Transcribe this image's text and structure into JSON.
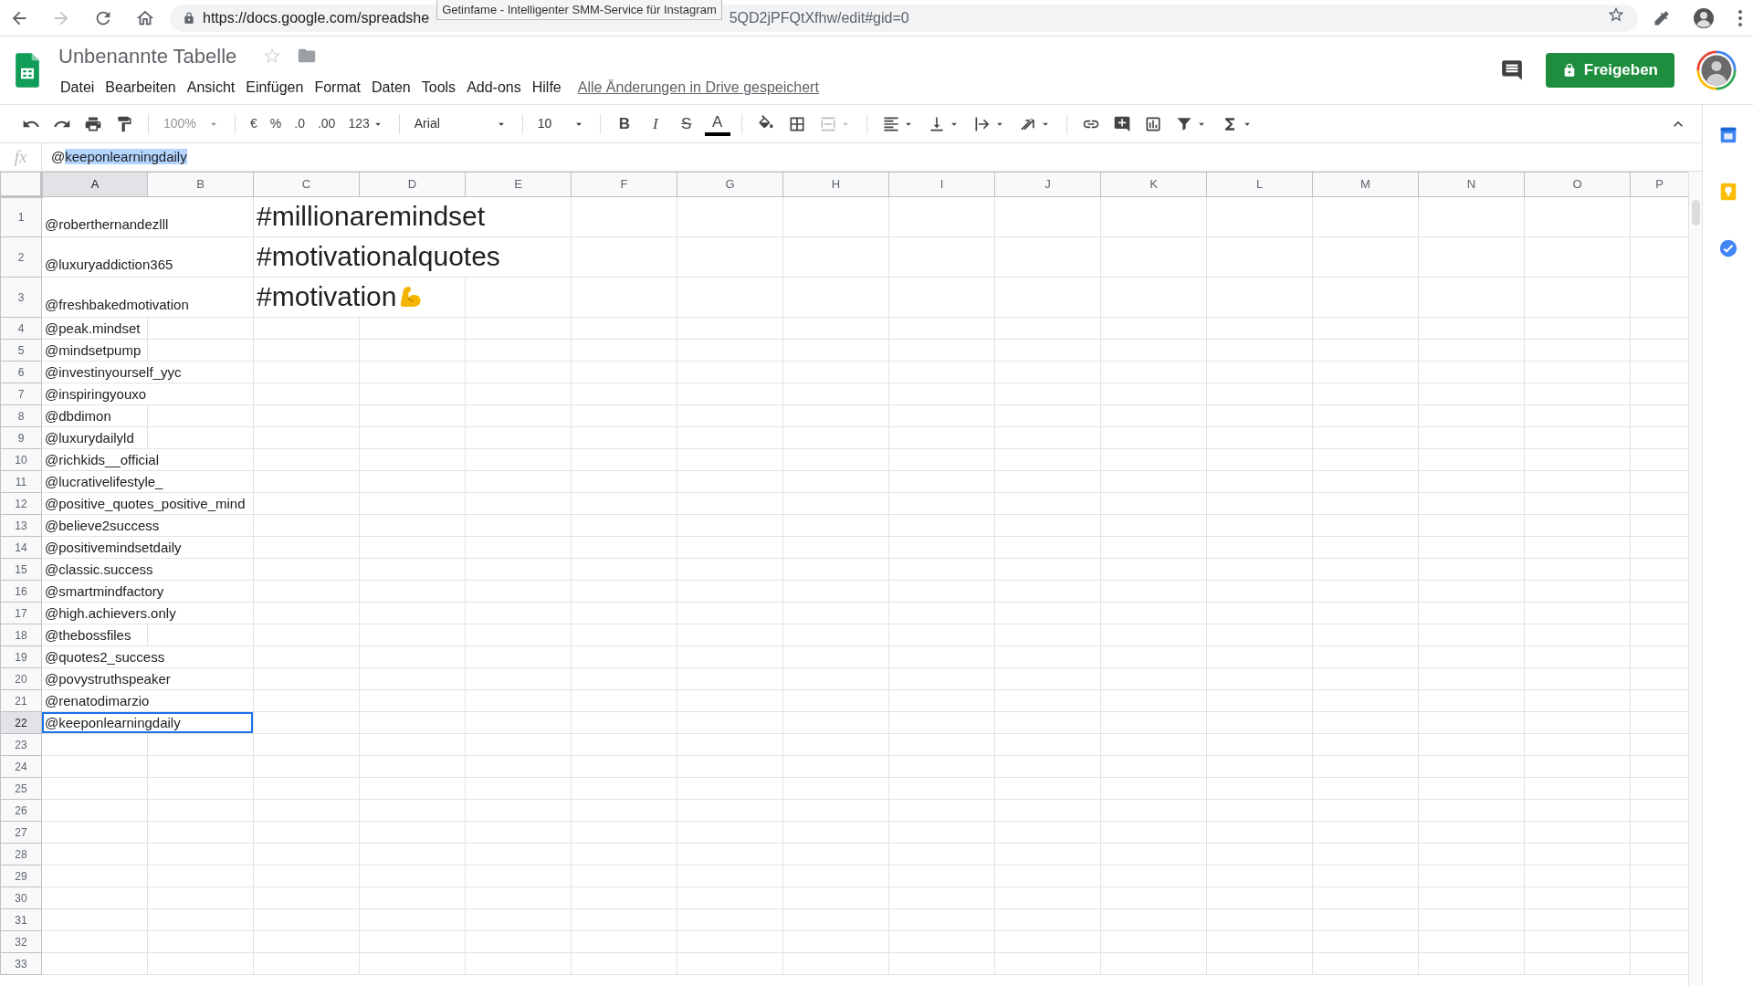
{
  "browser": {
    "url_start": "https://docs.google.com/spreadshe",
    "tooltip": "Getinfame - Intelligenter SMM-Service für Instagram",
    "url_end": "5QD2jPFQtXfhw/edit#gid=0",
    "forward_disabled": true
  },
  "document": {
    "title": "Unbenannte Tabelle",
    "menus": [
      "Datei",
      "Bearbeiten",
      "Ansicht",
      "Einfügen",
      "Format",
      "Daten",
      "Tools",
      "Add-ons",
      "Hilfe"
    ],
    "save_status": "Alle Änderungen in Drive gespeichert",
    "share_button": "Freigeben"
  },
  "toolbar": {
    "zoom": {
      "value": "100%",
      "disabled": true
    },
    "number_formats": [
      "€",
      "%",
      ".0",
      ".00",
      "123"
    ],
    "font": "Arial",
    "font_size": "10",
    "text_styles": [
      "B",
      "I",
      "S",
      "A"
    ],
    "merge_disabled": true
  },
  "formula_bar": {
    "label": "fx",
    "value": "@",
    "selected_text": "keeponlearningdaily"
  },
  "columns": [
    {
      "label": "A",
      "selected": true
    },
    {
      "label": "B",
      "selected": false
    },
    {
      "label": "C",
      "selected": false
    },
    {
      "label": "D",
      "selected": false
    },
    {
      "label": "E",
      "selected": false
    },
    {
      "label": "F",
      "selected": false
    },
    {
      "label": "G",
      "selected": false
    },
    {
      "label": "H",
      "selected": false
    },
    {
      "label": "I",
      "selected": false
    },
    {
      "label": "J",
      "selected": false
    },
    {
      "label": "K",
      "selected": false
    },
    {
      "label": "L",
      "selected": false
    },
    {
      "label": "M",
      "selected": false
    },
    {
      "label": "N",
      "selected": false
    },
    {
      "label": "O",
      "selected": false
    },
    {
      "label": "P",
      "selected": false
    }
  ],
  "rows": [
    {
      "number": "1",
      "a": "@roberthernandezlll",
      "c": "#millionaremindset",
      "selected": false
    },
    {
      "number": "2",
      "a": "@luxuryaddiction365",
      "c": "#motivationalquotes",
      "selected": false
    },
    {
      "number": "3",
      "a": "@freshbakedmotivation",
      "c": "#motivation",
      "icon": true,
      "selected": false
    },
    {
      "number": "4",
      "a": "@peak.mindset",
      "selected": false
    },
    {
      "number": "5",
      "a": "@mindsetpump",
      "selected": false
    },
    {
      "number": "6",
      "a": "@investinyourself_yyc",
      "selected": false
    },
    {
      "number": "7",
      "a": "@inspiringyouxo",
      "selected": false
    },
    {
      "number": "8",
      "a": "@dbdimon",
      "selected": false
    },
    {
      "number": "9",
      "a": "@luxurydailyld",
      "selected": false
    },
    {
      "number": "10",
      "a": "@richkids__official",
      "selected": false
    },
    {
      "number": "11",
      "a": "@lucrativelifestyle_",
      "selected": false
    },
    {
      "number": "12",
      "a": "@positive_quotes_positive_mind",
      "selected": false
    },
    {
      "number": "13",
      "a": "@believe2success",
      "selected": false
    },
    {
      "number": "14",
      "a": "@positivemindsetdaily",
      "selected": false
    },
    {
      "number": "15",
      "a": "@classic.success",
      "selected": false
    },
    {
      "number": "16",
      "a": "@smartmindfactory",
      "selected": false
    },
    {
      "number": "17",
      "a": "@high.achievers.only",
      "selected": false
    },
    {
      "number": "18",
      "a": "@thebossfiles",
      "selected": false
    },
    {
      "number": "19",
      "a": "@quotes2_success",
      "selected": false
    },
    {
      "number": "20",
      "a": "@povystruthspeaker",
      "selected": false
    },
    {
      "number": "21",
      "a": "@renatodimarzio",
      "selected": false
    },
    {
      "number": "22",
      "a": "@keeponlearningdaily",
      "selected": true
    },
    {
      "number": "23",
      "selected": false
    },
    {
      "number": "24",
      "selected": false
    },
    {
      "number": "25",
      "selected": false
    },
    {
      "number": "26",
      "selected": false
    },
    {
      "number": "27",
      "selected": false
    },
    {
      "number": "28",
      "selected": false
    },
    {
      "number": "29",
      "selected": false
    },
    {
      "number": "30",
      "selected": false
    },
    {
      "number": "31",
      "selected": false
    },
    {
      "number": "32",
      "selected": false
    },
    {
      "number": "33",
      "selected": false
    }
  ]
}
